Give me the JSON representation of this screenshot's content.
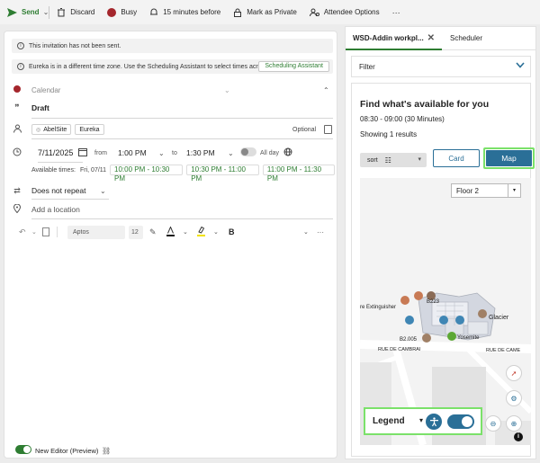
{
  "toolbar": {
    "send_label": "Send",
    "discard_label": "Discard",
    "busy_label": "Busy",
    "reminder_label": "15 minutes before",
    "private_label": "Mark as Private",
    "attendee_label": "Attendee Options",
    "more_label": "···"
  },
  "banners": {
    "not_sent": "This invitation has not been sent.",
    "timezone": "Eureka is in a different time zone. Use the Scheduling Assistant to select times acro...",
    "scheduling_assistant": "Scheduling Assistant"
  },
  "event": {
    "calendar_placeholder": "Calendar",
    "title": "Draft",
    "attendees": [
      "AbelSite",
      "Eureka"
    ],
    "optional_label": "Optional",
    "date": "7/11/2025",
    "from_label": "from",
    "start_time": "1:00 PM",
    "to_label": "to",
    "end_time": "1:30 PM",
    "all_day_label": "All day",
    "available_label": "Available times:",
    "available_day": "Fri, 07/11",
    "available_slots": [
      "10:00 PM - 10:30 PM",
      "10:30 PM - 11:00 PM",
      "11:00 PM - 11:30 PM"
    ],
    "repeat": "Does not repeat",
    "location_placeholder": "Add a location",
    "font_name": "Aptos",
    "font_size": "12",
    "bold_label": "B"
  },
  "footer": {
    "new_editor_label": "New Editor (Preview)"
  },
  "addin": {
    "tab_active": "WSD-Addin workpl...",
    "tab_2": "Scheduler",
    "filter_label": "Filter",
    "heading": "Find what's available for you",
    "time_range": "08:30 - 09:00 (30 Minutes)",
    "results": "Showing 1 results",
    "sort_label": "sort",
    "card_label": "Card",
    "map_label": "Map",
    "floor": "Floor 2",
    "map_labels": {
      "extinguisher": "re Extinguisher",
      "b223": "B223",
      "glacier": "Glacier",
      "b2005": "B2.005",
      "yosemite": "Yosemite",
      "rue1": "RUE DE CAMBRAI",
      "rue2": "RUE DE CAME"
    },
    "legend_label": "Legend"
  },
  "colors": {
    "accent_blue": "#2a6f97",
    "accent_green": "#2e7d32",
    "highlight_green": "#7be16a",
    "busy_red": "#a4262c"
  }
}
